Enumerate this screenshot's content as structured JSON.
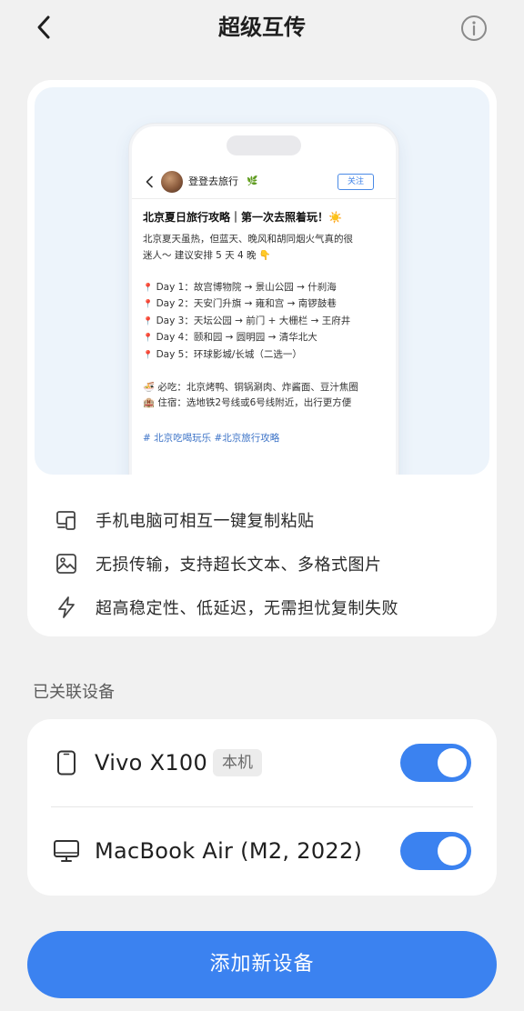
{
  "header": {
    "title": "超级互传"
  },
  "preview": {
    "author": "登登去旅行",
    "author_badge": "🌿",
    "follow_label": "关注",
    "post_title": "北京夏日旅行攻略｜第一次去照着玩！☀️",
    "intro_lines": [
      "北京夏天虽热，但蓝天、晚风和胡同烟火气真的很",
      "迷人～ 建议安排 5 天 4 晚 👇"
    ],
    "days": [
      "Day 1：故宫博物院 → 景山公园 → 什刹海",
      "Day 2：天安门升旗 → 雍和宫 → 南锣鼓巷",
      "Day 3：天坛公园 → 前门 + 大栅栏 → 王府井",
      "Day 4：颐和园 → 圆明园 → 清华北大",
      "Day 5：环球影城/长城（二选一）"
    ],
    "tips": [
      "🍜 必吃：北京烤鸭、铜锅涮肉、炸酱面、豆汁焦圈",
      "🏨 住宿：选地铁2号线或6号线附近，出行更方便"
    ],
    "tags": "# 北京吃喝玩乐 #北京旅行攻略"
  },
  "features": [
    {
      "icon": "devices-icon",
      "text": "手机电脑可相互一键复制粘贴"
    },
    {
      "icon": "image-icon",
      "text": "无损传输，支持超长文本、多格式图片"
    },
    {
      "icon": "lightning-icon",
      "text": "超高稳定性、低延迟，无需担忧复制失败"
    }
  ],
  "devices_section": {
    "label": "已关联设备",
    "devices": [
      {
        "name": "Vivo X100",
        "badge": "本机",
        "icon": "phone-icon",
        "enabled": true
      },
      {
        "name": "MacBook Air (M2, 2022)",
        "badge": "",
        "icon": "monitor-icon",
        "enabled": true
      }
    ]
  },
  "add_button": {
    "label": "添加新设备"
  },
  "colors": {
    "accent": "#3b82f0",
    "background": "#f1f1f1",
    "card": "#ffffff",
    "preview_bg": "#edf4fb"
  }
}
